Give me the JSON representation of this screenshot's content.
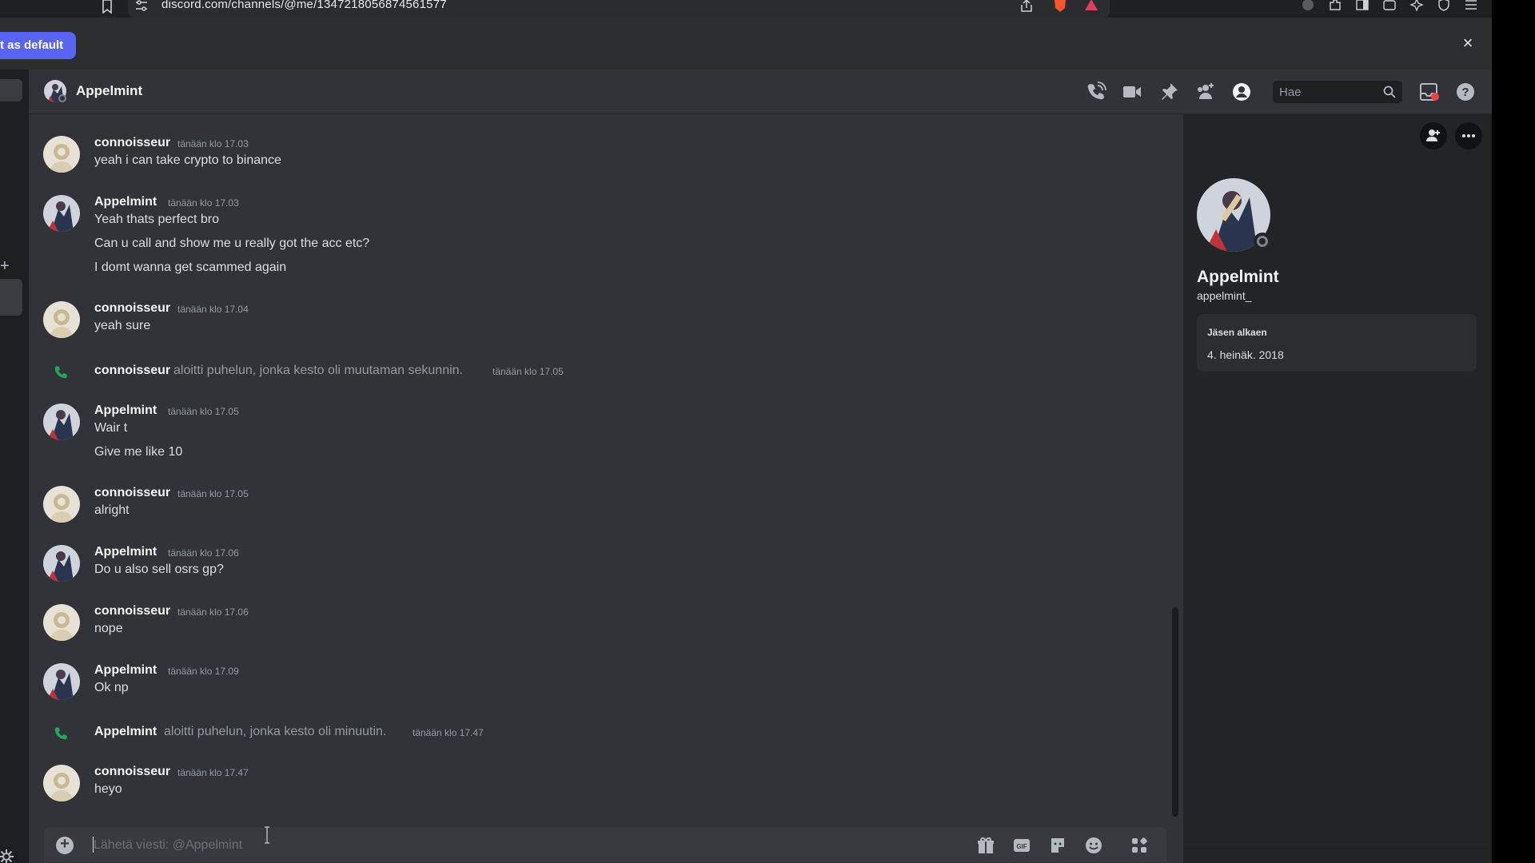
{
  "browser": {
    "url": "discord.com/channels/@me/1347218056874561577"
  },
  "info_bar": {
    "default_button": "t as default",
    "close": "×"
  },
  "header": {
    "channel_name": "Appelmint",
    "search_placeholder": "Hae"
  },
  "messages": [
    {
      "type": "message",
      "author": "connoisseur",
      "time": "tänään klo 17.03",
      "lines": [
        "yeah i can take crypto to binance"
      ]
    },
    {
      "type": "message",
      "author": "Appelmint",
      "time": "tänään klo 17.03",
      "lines": [
        "Yeah thats perfect bro",
        "Can u call and show me u really got the acc etc?",
        "I domt wanna get scammed again"
      ]
    },
    {
      "type": "message",
      "author": "connoisseur",
      "time": "tänään klo 17.04",
      "lines": [
        "yeah sure"
      ]
    },
    {
      "type": "call",
      "author": "connoisseur",
      "text": "aloitti puhelun, jonka kesto oli muutaman sekunnin.",
      "time": "tänään klo 17.05"
    },
    {
      "type": "message",
      "author": "Appelmint",
      "time": "tänään klo 17.05",
      "lines": [
        "Wair t",
        "Give me like 10"
      ]
    },
    {
      "type": "message",
      "author": "connoisseur",
      "time": "tänään klo 17.05",
      "lines": [
        "alright"
      ]
    },
    {
      "type": "message",
      "author": "Appelmint",
      "time": "tänään klo 17.06",
      "lines": [
        "Do u also sell osrs gp?"
      ]
    },
    {
      "type": "message",
      "author": "connoisseur",
      "time": "tänään klo 17.06",
      "lines": [
        "nope"
      ]
    },
    {
      "type": "message",
      "author": "Appelmint",
      "time": "tänään klo 17.09",
      "lines": [
        "Ok np"
      ]
    },
    {
      "type": "call",
      "author": "Appelmint",
      "text": "aloitti puhelun, jonka kesto oli minuutin.",
      "time": "tänään klo 17.47"
    },
    {
      "type": "message",
      "author": "connoisseur",
      "time": "tänään klo 17.47",
      "lines": [
        "heyo"
      ]
    }
  ],
  "composer": {
    "placeholder": "Lähetä viesti: @Appelmint"
  },
  "profile": {
    "display_name": "Appelmint",
    "username": "appelmint_",
    "member_since_label": "Jäsen alkaen",
    "member_since_value": "4. heinäk. 2018"
  },
  "colors": {
    "accent": "#5865f2",
    "call_green": "#23a55a",
    "background": "#313338",
    "panel": "#232428"
  }
}
